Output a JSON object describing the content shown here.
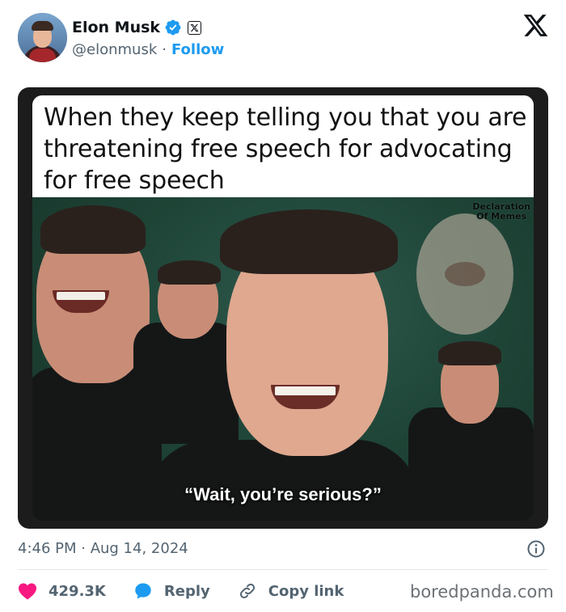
{
  "author": {
    "name": "Elon Musk",
    "handle": "@elonmusk",
    "separator": "·",
    "follow_label": "Follow",
    "verified_icon": "verified-badge-icon",
    "affiliate_icon": "x-affiliate-icon"
  },
  "platform_logo": "x-logo-icon",
  "media": {
    "caption": "When they keep telling you that you are threatening free speech for advocating for free speech",
    "watermark_line1": "Declaration",
    "watermark_line2": "Of Memes",
    "subtitle": "“Wait, you’re serious?”"
  },
  "footer": {
    "timestamp": "4:46 PM · Aug 14, 2024",
    "likes_count": "429.3K",
    "reply_label": "Reply",
    "copy_link_label": "Copy link"
  },
  "colors": {
    "accent": "#1d9bf0",
    "like": "#f91880",
    "muted": "#536471"
  },
  "source_brand": "boredpanda.com"
}
